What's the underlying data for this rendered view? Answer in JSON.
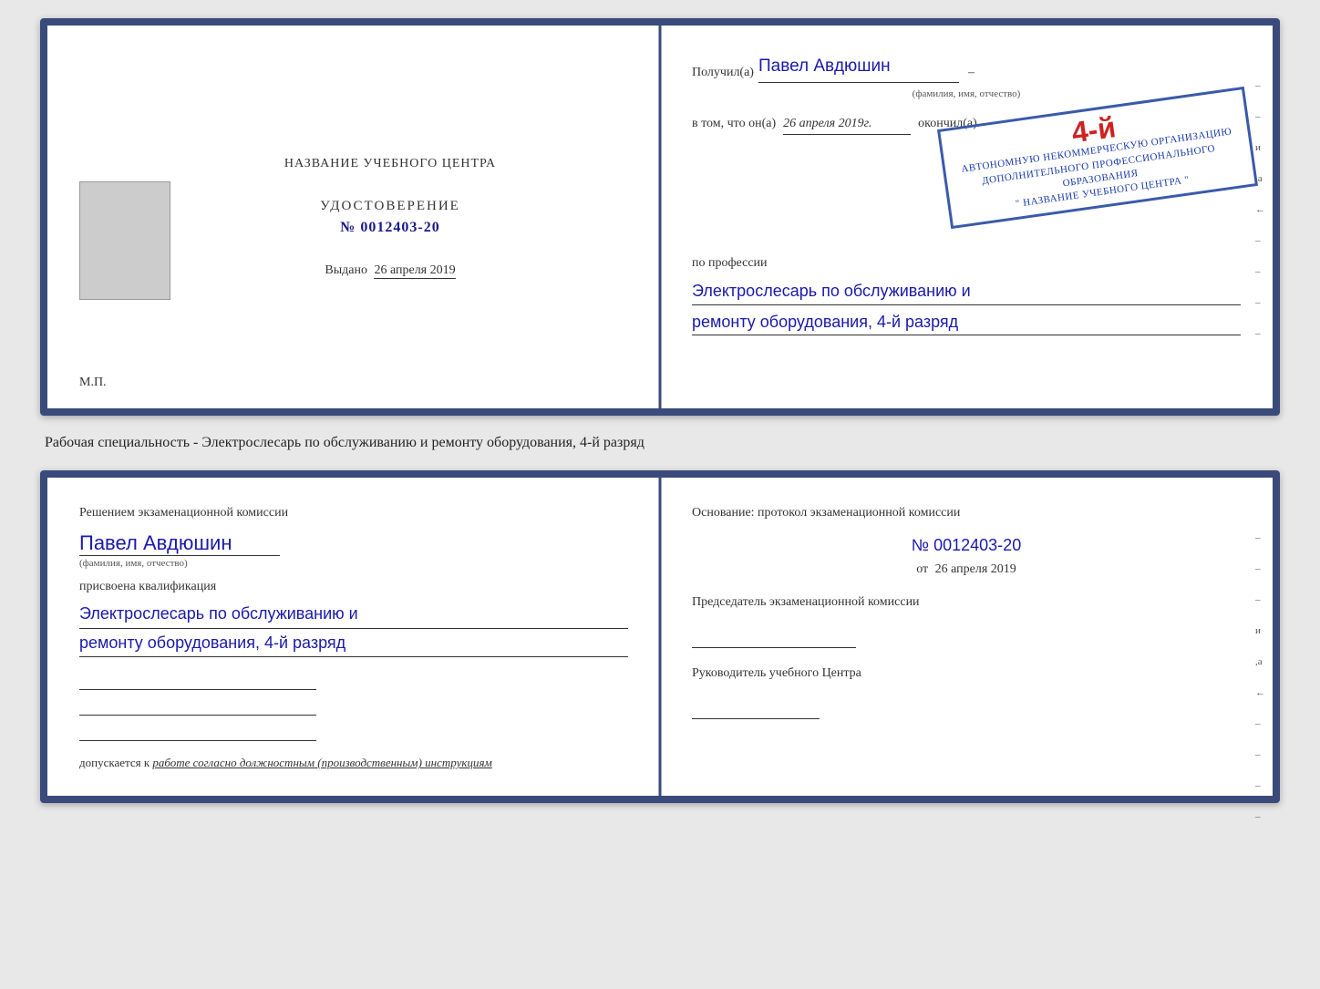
{
  "top_left": {
    "title": "НАЗВАНИЕ УЧЕБНОГО ЦЕНТРА",
    "cert_label": "УДОСТОВЕРЕНИЕ",
    "cert_number": "№ 0012403-20",
    "issued_label": "Выдано",
    "issued_date": "26 апреля 2019",
    "mp_label": "М.П."
  },
  "top_right": {
    "received_label": "Получил(а)",
    "recipient_name": "Павел Авдюшин",
    "fio_hint": "(фамилия, имя, отчество)",
    "vtom_label": "в том, что он(а)",
    "completion_date": "26 апреля 2019г.",
    "finished_label": "окончил(а)",
    "stamp_line1": "АВТОНОМНУЮ НЕКОММЕРЧЕСКУЮ ОРГАНИЗАЦИЮ",
    "stamp_line2": "ДОПОЛНИТЕЛЬНОГО ПРОФЕССИОНАЛЬНОГО ОБРАЗОВАНИЯ",
    "stamp_org_name": "\" НАЗВАНИЕ УЧЕБНОГО ЦЕНТРА \"",
    "stamp_grade": "4-й",
    "profession_label": "по профессии",
    "profession_text": "Электрослесарь по обслуживанию и",
    "profession_text2": "ремонту оборудования, 4-й разряд",
    "right_marks": [
      "–",
      "–",
      "и",
      ",а",
      "←",
      "–",
      "–",
      "–",
      "–"
    ]
  },
  "description": {
    "text": "Рабочая специальность - Электрослесарь по обслуживанию и ремонту оборудования, 4-й разряд"
  },
  "bottom_left": {
    "section_label": "Решением экзаменационной комиссии",
    "person_name": "Павел Авдюшин",
    "fio_hint": "(фамилия, имя, отчество)",
    "assigned_label": "присвоена квалификация",
    "qualification_line1": "Электрослесарь по обслуживанию и",
    "qualification_line2": "ремонту оборудования, 4-й разряд",
    "allowed_label": "допускается к",
    "allowed_text": "работе согласно должностным (производственным) инструкциям"
  },
  "bottom_right": {
    "basis_label": "Основание: протокол экзаменационной комиссии",
    "protocol_number": "№ 0012403-20",
    "date_from_prefix": "от",
    "date_from": "26 апреля 2019",
    "chairman_label": "Председатель экзаменационной комиссии",
    "head_label": "Руководитель учебного Центра",
    "right_marks": [
      "–",
      "–",
      "–",
      "и",
      ",а",
      "←",
      "–",
      "–",
      "–",
      "–"
    ]
  }
}
